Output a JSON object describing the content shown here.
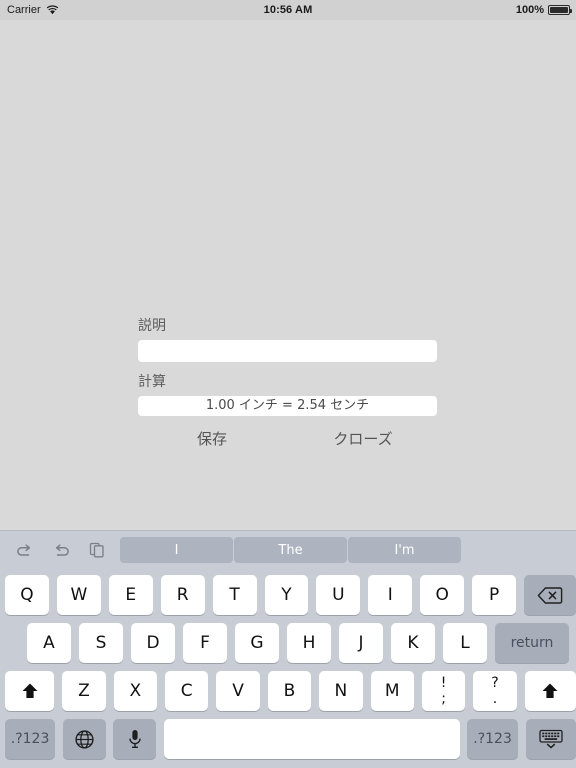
{
  "status_bar": {
    "carrier": "Carrier",
    "wifi_icon": "wifi-icon",
    "time": "10:56 AM",
    "battery_percent": "100%",
    "battery_icon": "battery-full-icon"
  },
  "form": {
    "description_label": "説明",
    "description_value": "",
    "description_placeholder": "",
    "calculation_label": "計算",
    "calculation_value": "1.00 インチ = 2.54 センチ",
    "save_label": "保存",
    "close_label": "クローズ"
  },
  "keyboard": {
    "toolbar": {
      "undo_icon": "undo-icon",
      "redo_icon": "redo-icon",
      "copy_icon": "copy-paste-icon",
      "suggestions": [
        "I",
        "The",
        "I'm"
      ]
    },
    "row1": [
      "Q",
      "W",
      "E",
      "R",
      "T",
      "Y",
      "U",
      "I",
      "O",
      "P"
    ],
    "row1_action": "backspace-icon",
    "row2": [
      "A",
      "S",
      "D",
      "F",
      "G",
      "H",
      "J",
      "K",
      "L"
    ],
    "return_label": "return",
    "row3": [
      "Z",
      "X",
      "C",
      "V",
      "B",
      "N",
      "M"
    ],
    "shift_icon": "shift-icon",
    "punc1_top": "!",
    "punc1_bottom": ";",
    "punc2_top": "?",
    "punc2_bottom": ".",
    "numeric_label": ".?123",
    "globe_icon": "globe-icon",
    "mic_icon": "microphone-icon",
    "space_label": "",
    "hide_keyboard_icon": "hide-keyboard-icon"
  },
  "colors": {
    "background": "#d9d9d9",
    "keyboard_bg": "#c8ccd4",
    "key_light": "#ffffff",
    "key_dark": "#a7aeb9",
    "suggestion_bg": "#adb4bf",
    "field_white": "#ffffff",
    "label_gray": "#5c5c5c"
  }
}
